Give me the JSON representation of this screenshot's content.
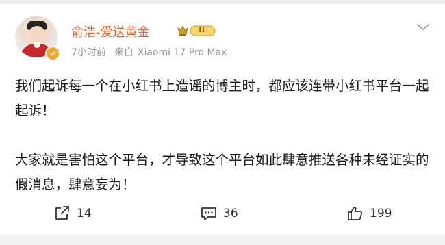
{
  "post": {
    "author": {
      "name": "俞浩-爱送黄金",
      "badge_level": "II",
      "avatar_icon": "avatar-photo",
      "verified_icon": "verified-badge-icon",
      "verified_color": "#f5a623"
    },
    "meta": {
      "time": "7小时前",
      "source_prefix": "来自",
      "source_device": "Xiaomi 17 Pro Max"
    },
    "paragraphs": [
      "我们起诉每一个在小红书上造谣的博主时，都应该连带小红书平台一起起诉！",
      "大家就是害怕这个平台，才导致这个平台如此肆意推送各种未经证实的假消息，肆意妄为！"
    ],
    "actions": {
      "share_count": "14",
      "comment_count": "36",
      "like_count": "199"
    }
  },
  "colors": {
    "username": "#e4672b",
    "meta": "#939393",
    "text": "#1a1a1a",
    "background": "#f2f2f2"
  }
}
